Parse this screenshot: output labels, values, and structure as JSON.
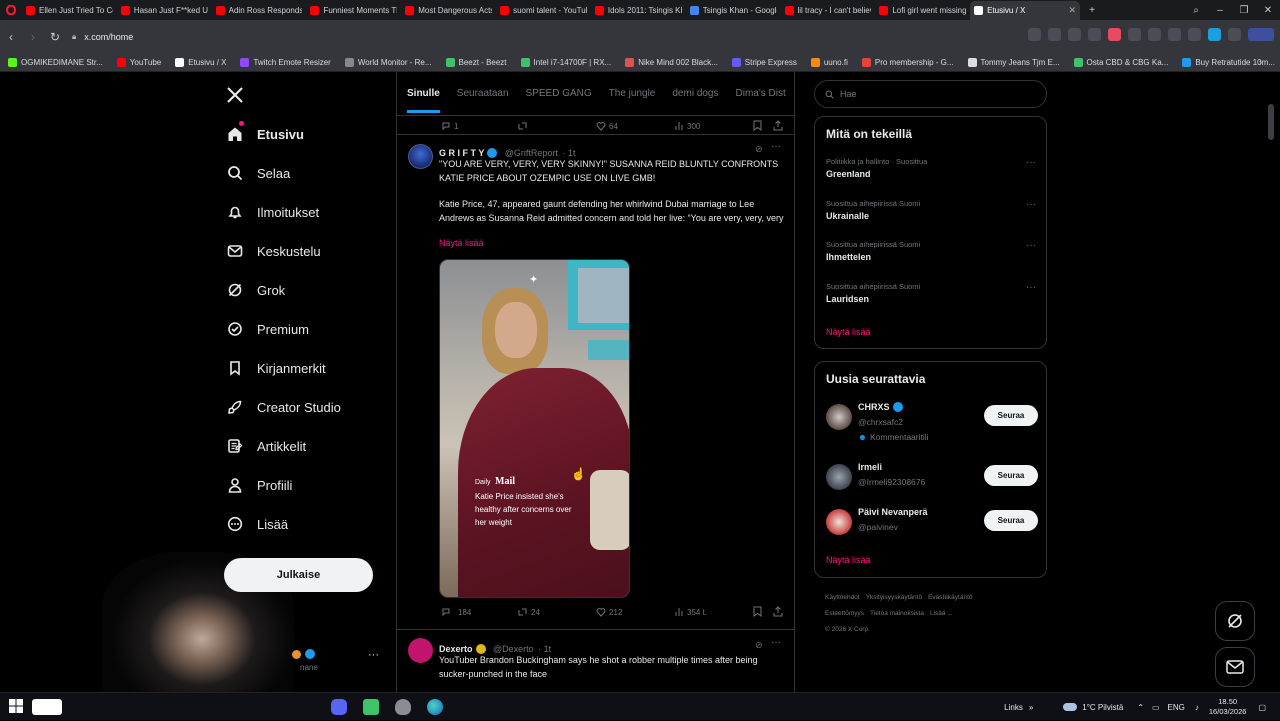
{
  "browser": {
    "tabs": [
      {
        "title": "Ellen Just Tried To Con",
        "color": "#ff0000"
      },
      {
        "title": "Hasan Just F**ked Up",
        "color": "#ff0000"
      },
      {
        "title": "Adin Ross Responds t",
        "color": "#ff0000"
      },
      {
        "title": "Funniest Moments Th",
        "color": "#ff0000"
      },
      {
        "title": "Most Dangerous Acts",
        "color": "#ff0000"
      },
      {
        "title": "suomi talent - YouTub",
        "color": "#ff0000"
      },
      {
        "title": "Idols 2011: Tsingis Kha",
        "color": "#ff0000"
      },
      {
        "title": "Tsingis Khan - Google",
        "color": "#4285f4"
      },
      {
        "title": "lil tracy - I can't believ",
        "color": "#ff0000"
      },
      {
        "title": "Lofi girl went missing",
        "color": "#ff0000"
      },
      {
        "title": "Etusivu / X",
        "color": "#ffffff",
        "active": true
      }
    ],
    "url": "x.com/home",
    "bookmarks": [
      {
        "label": "OGMIKEDIMANE Str...",
        "color": "#53fc18"
      },
      {
        "label": "YouTube",
        "color": "#ff0000"
      },
      {
        "label": "Etusivu / X",
        "color": "#ffffff"
      },
      {
        "label": "Twitch Emote Resizer",
        "color": "#9146ff"
      },
      {
        "label": "World Monitor - Re...",
        "color": "#888888"
      },
      {
        "label": "Beezt - Beezt",
        "color": "#3cc36b"
      },
      {
        "label": "Intel i7-14700F | RX...",
        "color": "#3cc36b"
      },
      {
        "label": "Nike Mind 002 Black...",
        "color": "#e05252"
      },
      {
        "label": "Stripe Express",
        "color": "#635bff"
      },
      {
        "label": "uuno.fi",
        "color": "#ff8a00"
      },
      {
        "label": "Pro membership - G...",
        "color": "#ea4335"
      },
      {
        "label": "Tommy Jeans Tjm E...",
        "color": "#dddddd"
      },
      {
        "label": "Osta CBD & CBG Ka...",
        "color": "#3cc36b"
      },
      {
        "label": "Buy Retratutide 10m...",
        "color": "#1d9bf0"
      }
    ]
  },
  "nav": {
    "items": [
      {
        "label": "Etusivu",
        "icon": "home-icon"
      },
      {
        "label": "Selaa",
        "icon": "search-icon"
      },
      {
        "label": "Ilmoitukset",
        "icon": "bell-icon"
      },
      {
        "label": "Keskustelu",
        "icon": "mail-icon"
      },
      {
        "label": "Grok",
        "icon": "grok-icon"
      },
      {
        "label": "Premium",
        "icon": "premium-icon"
      },
      {
        "label": "Kirjanmerkit",
        "icon": "bookmark-icon"
      },
      {
        "label": "Creator Studio",
        "icon": "rocket-icon"
      },
      {
        "label": "Artikkelit",
        "icon": "article-icon"
      },
      {
        "label": "Profiili",
        "icon": "profile-icon"
      },
      {
        "label": "Lisää",
        "icon": "more-icon"
      }
    ],
    "post_button": "Julkaise",
    "account_handle_partial": "nane"
  },
  "feed": {
    "tabs": [
      "Sinulle",
      "Seuraataan",
      "SPEED GANG",
      "The jungle",
      "demi dogs",
      "Dima's Dist"
    ],
    "top_actions": {
      "replies": "1",
      "likes": "64",
      "views": "300"
    },
    "tweet1": {
      "name": "G R I F T Y",
      "handle": "@GriftReport",
      "time": "· 1t",
      "headline": "\"YOU ARE VERY, VERY, VERY SKINNY!\" SUSANNA REID BLUNTLY CONFRONTS KATIE PRICE ABOUT OZEMPIC USE ON LIVE GMB!",
      "body": "Katie Price, 47, appeared gaunt defending her whirlwind Dubai marriage to Lee Andrews as Susanna Reid admitted concern and told her live: “You are very, very, very",
      "show_more": "Näytä lisää",
      "media_brand_small": "Daily",
      "media_brand": "Mail",
      "media_caption": "Katie Price insisted she's healthy after concerns over her weight",
      "replies": "184",
      "reposts": "24",
      "likes": "212",
      "views": "354 t."
    },
    "tweet2": {
      "name": "Dexerto",
      "handle": "@Dexerto",
      "time": "· 1t",
      "body": "YouTuber Brandon Buckingham says he shot a robber multiple times after being sucker-punched in the face"
    }
  },
  "sidebar": {
    "search_placeholder": "Hae",
    "trends_title": "Mitä on tekeillä",
    "trends": [
      {
        "context": "Politiikka ja hallinto · Suosittua",
        "name": "Greenland"
      },
      {
        "context": "Suosittua aihepiirissä Suomi",
        "name": "Ukrainalle"
      },
      {
        "context": "Suosittua aihepiirissä Suomi",
        "name": "Ihmettelen"
      },
      {
        "context": "Suosittua aihepiirissä Suomi",
        "name": "Lauridsen"
      }
    ],
    "trends_more": "Näytä lisää",
    "follow_title": "Uusia seurattavia",
    "follow": [
      {
        "name": "CHRXS",
        "handle": "@chrxsafc2",
        "extra": "Kommentaaritili",
        "button": "Seuraa",
        "verified": true
      },
      {
        "name": "Irmeli",
        "handle": "@Irmeli92308676",
        "extra": "",
        "button": "Seuraa",
        "verified": false
      },
      {
        "name": "Päivi Nevanperä",
        "handle": "@paivinev",
        "extra": "",
        "button": "Seuraa",
        "verified": false
      }
    ],
    "follow_more": "Näytä lisää",
    "footer": [
      "Käyttöehdot",
      "Yksityisyyskäytäntö",
      "Evästekäytäntö",
      "Esteettömyys",
      "Tietoa mainoksista",
      "Lisää ...",
      "© 2026 X Corp."
    ]
  },
  "taskbar": {
    "links": "Links",
    "weather": "1°C  Pilvistä",
    "lang": "ENG",
    "time": "18.50",
    "date": "16/03/2026"
  },
  "colors": {
    "accent_pink": "#f91880",
    "verified_blue": "#1d9bf0",
    "border": "#2f3336"
  }
}
